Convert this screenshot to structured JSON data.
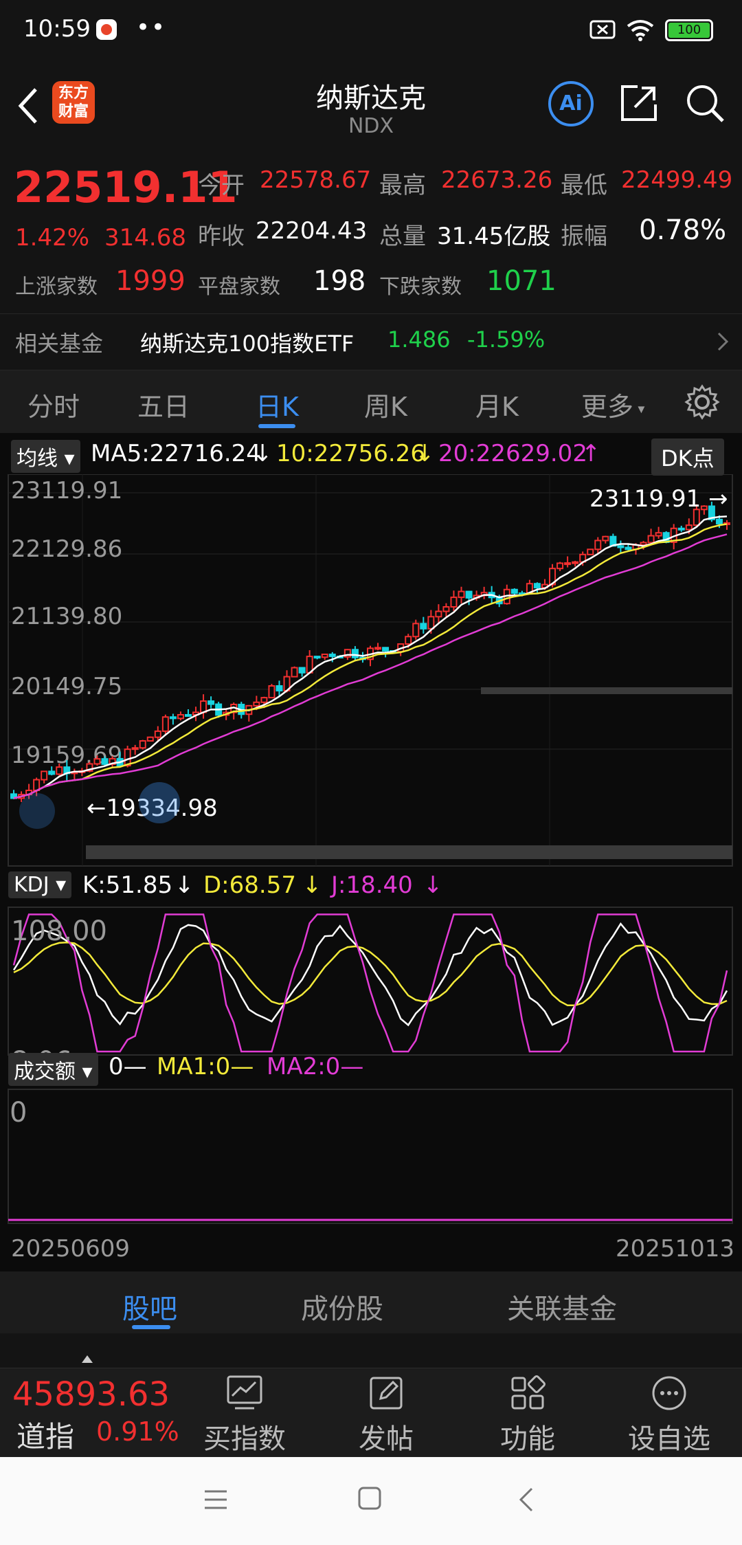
{
  "status_bar": {
    "time": "10:59",
    "dots": "••",
    "battery": "100"
  },
  "header": {
    "title": "纳斯达克",
    "code": "NDX",
    "logo_line1": "东方",
    "logo_line2": "财富",
    "ai_label": "Ai"
  },
  "quote": {
    "price": "22519.11",
    "change_pct": "1.42%",
    "change": "314.68",
    "open_label": "今开",
    "open": "22578.67",
    "high_label": "最高",
    "high": "22673.26",
    "low_label": "最低",
    "low": "22499.49",
    "prev_label": "昨收",
    "prev": "22204.43",
    "volume_label": "总量",
    "volume": "31.45亿股",
    "amplitude_label": "振幅",
    "amplitude": "0.78%",
    "up_label": "上涨家数",
    "up": "1999",
    "flat_label": "平盘家数",
    "flat": "198",
    "down_label": "下跌家数",
    "down": "1071",
    "fund_label": "相关基金",
    "fund_name": "纳斯达克100指数ETF",
    "fund_price": "1.486",
    "fund_change": "-1.59%"
  },
  "period_tabs": [
    "分时",
    "五日",
    "日K",
    "周K",
    "月K",
    "更多"
  ],
  "active_period": 2,
  "ma_bar": {
    "selector": "均线",
    "ma5": "MA5:22716.24",
    "ma10": "10:22756.26",
    "ma20": "20:22629.02",
    "dk": "DK点"
  },
  "kdj_bar": {
    "selector": "KDJ",
    "k": "K:51.85",
    "d": "D:68.57",
    "j": "J:18.40"
  },
  "vol_bar": {
    "selector": "成交额",
    "v": "0—",
    "ma1": "MA1:0—",
    "ma2": "MA2:0—"
  },
  "chart_data": {
    "type": "candlestick",
    "y_ticks": [
      "23119.91",
      "22129.86",
      "21139.80",
      "20149.75",
      "19159.69"
    ],
    "max_label": "23119.91",
    "min_label": "19334.98",
    "kdj_ticks": [
      "108.00",
      "8.06"
    ],
    "vol_tick": "0",
    "x_start": "20250609",
    "x_end": "20251013",
    "colors": {
      "up": "#f23030",
      "down": "#19d3e0",
      "ma5": "#ffffff",
      "ma10": "#f3ea3a",
      "ma20": "#e23cd5"
    }
  },
  "bottom_tabs": [
    "股吧",
    "成份股",
    "关联基金"
  ],
  "ticker": {
    "value": "45893.63",
    "name": "道指",
    "pct": "0.91%"
  },
  "toolbar": [
    "买指数",
    "发帖",
    "功能",
    "设自选"
  ]
}
